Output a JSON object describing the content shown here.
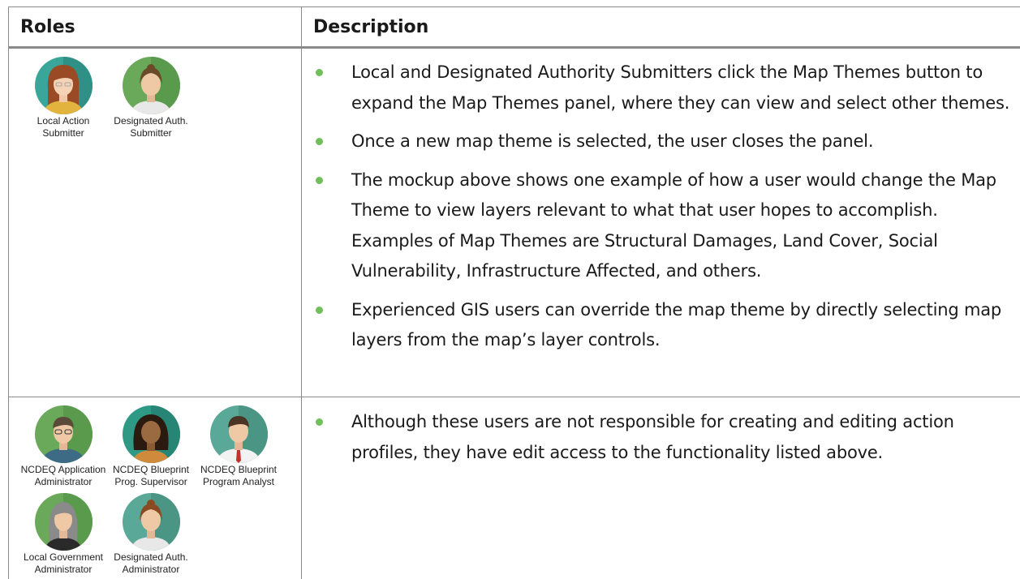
{
  "table": {
    "headers": {
      "roles": "Roles",
      "description": "Description"
    },
    "rows": [
      {
        "roles": [
          {
            "label": "Local Action\nSubmitter",
            "icon": "woman-avatar-icon"
          },
          {
            "label": "Designated Auth.\nSubmitter",
            "icon": "woman-avatar-icon"
          }
        ],
        "bullets": [
          "Local and Designated Authority Submitters click the Map Themes button to expand the Map Themes panel, where they can view and select other themes.",
          "Once a new map theme is selected, the user closes the panel.",
          "The mockup above shows one example of how a user would change the Map Theme to view layers relevant to what that user hopes to accomplish. Examples of Map Themes are Structural Damages, Land Cover, Social Vulnerability, Infrastructure Affected, and others.",
          "Experienced GIS users can override the map theme by directly selecting map layers from the map’s layer controls."
        ]
      },
      {
        "roles": [
          {
            "label": "NCDEQ Application\nAdministrator",
            "icon": "man-glasses-avatar-icon"
          },
          {
            "label": "NCDEQ Blueprint\nProg. Supervisor",
            "icon": "woman-avatar-icon"
          },
          {
            "label": "NCDEQ Blueprint\nProgram Analyst",
            "icon": "man-tie-avatar-icon"
          },
          {
            "label": "Local Government\nAdministrator",
            "icon": "woman-avatar-icon"
          },
          {
            "label": "Designated Auth.\nAdministrator",
            "icon": "woman-avatar-icon"
          }
        ],
        "bullets": [
          "Although these users are not responsible for creating and editing action profiles, they have edit access to the functionality listed above."
        ]
      }
    ]
  },
  "colors": {
    "bullet": "#6fbf5a",
    "rule": "#8a8a8a"
  }
}
